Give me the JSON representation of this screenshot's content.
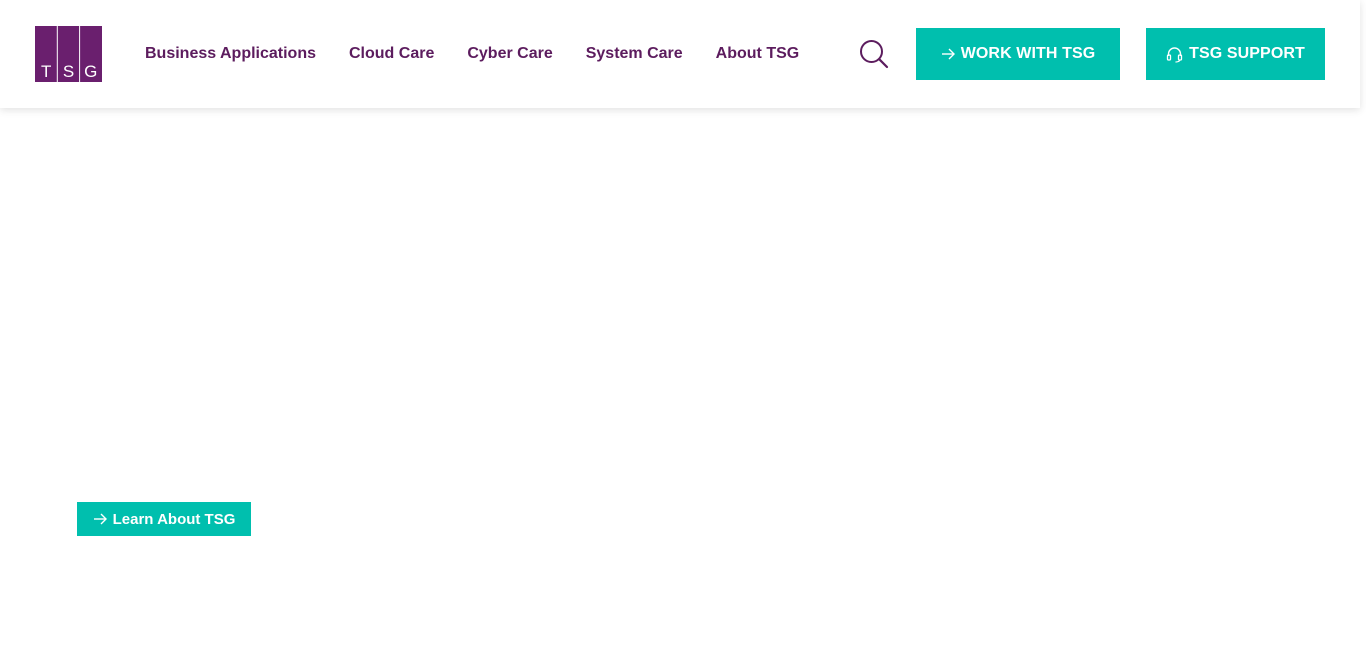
{
  "header": {
    "logo": {
      "letters": [
        "T",
        "S",
        "G"
      ],
      "icon": "tsg-logo",
      "color": "#6a1f6e"
    },
    "nav": [
      {
        "label": "Business Applications"
      },
      {
        "label": "Cloud Care"
      },
      {
        "label": "Cyber Care"
      },
      {
        "label": "System Care"
      },
      {
        "label": "About TSG"
      }
    ],
    "search": {
      "icon": "search-icon"
    },
    "work_button": {
      "label": "WORK WITH TSG",
      "icon": "arrow-right-icon"
    },
    "support_button": {
      "label": "TSG SUPPORT",
      "icon": "headset-icon"
    }
  },
  "hero": {
    "learn_button": {
      "label": "Learn About TSG",
      "icon": "arrow-right-icon"
    }
  },
  "colors": {
    "brand_purple": "#5c1c5e",
    "accent_teal": "#00bfae",
    "background": "#ffffff"
  }
}
